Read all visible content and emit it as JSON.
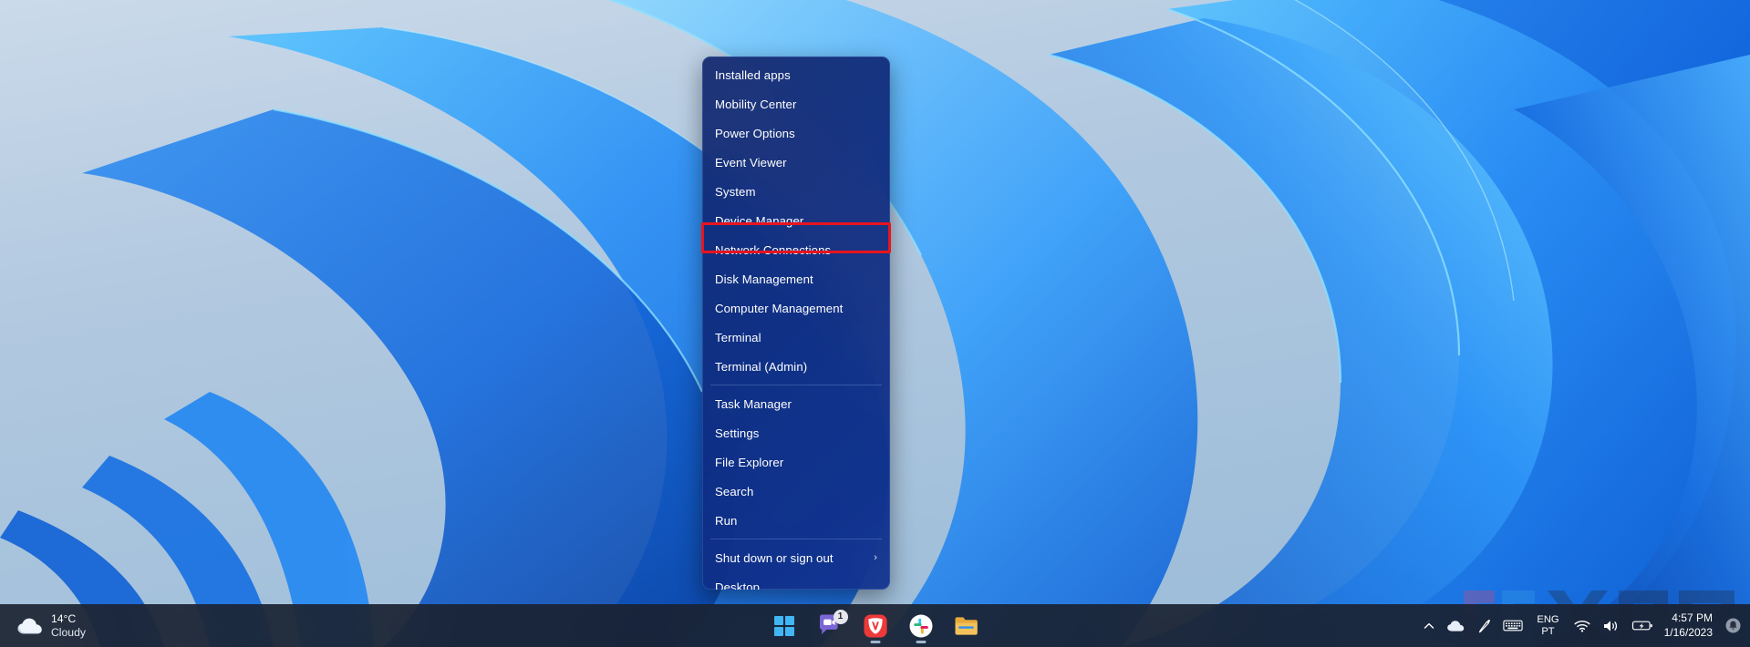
{
  "desktop": {
    "wallpaper_name": "windows-11-bloom-blue",
    "background_top_color": "#c3d4e6",
    "background_bottom_color": "#9dbcd9",
    "ribbon_color": "#1b7ff0",
    "ribbon_highlight_color": "#4fc3ff"
  },
  "winx_menu": {
    "name": "Win+X power user menu",
    "highlighted_item": "Device Manager",
    "highlight_color": "#e8141e",
    "groups": [
      {
        "items": [
          {
            "label": "Installed apps",
            "submenu": false
          },
          {
            "label": "Mobility Center",
            "submenu": false
          },
          {
            "label": "Power Options",
            "submenu": false
          },
          {
            "label": "Event Viewer",
            "submenu": false
          },
          {
            "label": "System",
            "submenu": false
          },
          {
            "label": "Device Manager",
            "submenu": false
          },
          {
            "label": "Network Connections",
            "submenu": false
          },
          {
            "label": "Disk Management",
            "submenu": false
          },
          {
            "label": "Computer Management",
            "submenu": false
          },
          {
            "label": "Terminal",
            "submenu": false
          },
          {
            "label": "Terminal (Admin)",
            "submenu": false
          }
        ]
      },
      {
        "items": [
          {
            "label": "Task Manager",
            "submenu": false
          },
          {
            "label": "Settings",
            "submenu": false
          },
          {
            "label": "File Explorer",
            "submenu": false
          },
          {
            "label": "Search",
            "submenu": false
          },
          {
            "label": "Run",
            "submenu": false
          }
        ]
      },
      {
        "items": [
          {
            "label": "Shut down or sign out",
            "submenu": true,
            "chevron": "›"
          },
          {
            "label": "Desktop",
            "submenu": false
          }
        ]
      }
    ]
  },
  "taskbar": {
    "weather": {
      "icon": "cloud-icon",
      "temperature": "14°C",
      "condition": "Cloudy"
    },
    "pinned": [
      {
        "name": "start-button",
        "label": "Start",
        "icon": "windows-logo-icon",
        "badge": null,
        "running": false
      },
      {
        "name": "chat-button",
        "label": "Chat",
        "icon": "teams-chat-icon",
        "badge": "1",
        "running": false
      },
      {
        "name": "vivaldi-button",
        "label": "Vivaldi",
        "icon": "vivaldi-icon",
        "badge": null,
        "running": true
      },
      {
        "name": "slack-button",
        "label": "Slack",
        "icon": "slack-icon",
        "badge": null,
        "running": true
      },
      {
        "name": "file-explorer-button",
        "label": "File Explorer",
        "icon": "folder-icon",
        "badge": null,
        "running": false
      }
    ],
    "tray": {
      "overflow_icon": "chevron-up-icon",
      "onedrive_icon": "cloud-onedrive-icon",
      "pen_icon": "pen-icon",
      "keyboard_icon": "touch-keyboard-icon",
      "language_line1": "ENG",
      "language_line2": "PT",
      "network_icon": "wifi-icon",
      "volume_icon": "speaker-icon",
      "battery_icon": "battery-icon",
      "time": "4:57 PM",
      "date": "1/16/2023",
      "notification_icon": "bell-icon"
    }
  },
  "watermark": {
    "text": "XDA",
    "bracket_left_color": "#e2456a",
    "bracket_right_color": "#3aa3e8"
  }
}
